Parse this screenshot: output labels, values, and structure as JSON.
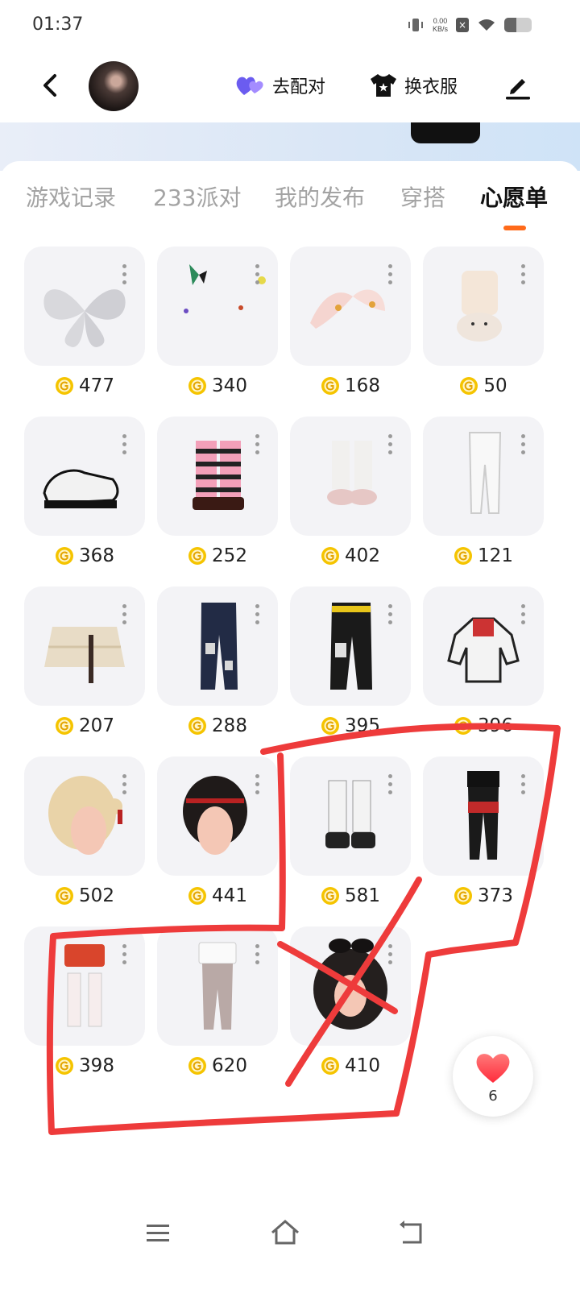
{
  "status_bar": {
    "time": "01:37",
    "net_speed_value": "0.00",
    "net_speed_unit": "KB/s",
    "battery_level": 0.45
  },
  "header": {
    "match_label": "去配对",
    "dress_label": "换衣服"
  },
  "tabs": [
    {
      "label": "游戏记录",
      "active": false
    },
    {
      "label": "233派对",
      "active": false
    },
    {
      "label": "我的发布",
      "active": false
    },
    {
      "label": "穿搭",
      "active": false
    },
    {
      "label": "心愿单",
      "active": true
    }
  ],
  "wishlist": [
    {
      "name": "white-fairy-wings",
      "price": "477"
    },
    {
      "name": "butterfly-accessory",
      "price": "340"
    },
    {
      "name": "bunny-ear-headband",
      "price": "168"
    },
    {
      "name": "bunny-socks-slippers",
      "price": "50"
    },
    {
      "name": "black-white-sneakers",
      "price": "368"
    },
    {
      "name": "pink-striped-platform-boots",
      "price": "252"
    },
    {
      "name": "lace-pink-boots",
      "price": "402"
    },
    {
      "name": "white-tights",
      "price": "121"
    },
    {
      "name": "tiered-lace-skirt",
      "price": "207"
    },
    {
      "name": "flare-jeans",
      "price": "288"
    },
    {
      "name": "black-yellow-cargo-pants",
      "price": "395"
    },
    {
      "name": "punk-jacket",
      "price": "396"
    },
    {
      "name": "blonde-bun-hair",
      "price": "502"
    },
    {
      "name": "black-ribbon-hair",
      "price": "441"
    },
    {
      "name": "butterfly-lace-up-boots",
      "price": "581"
    },
    {
      "name": "black-red-strap-leggings",
      "price": "373"
    },
    {
      "name": "red-shorts-white-stockings",
      "price": "398"
    },
    {
      "name": "white-lace-leggings",
      "price": "620"
    },
    {
      "name": "black-bow-long-hair",
      "price": "410"
    }
  ],
  "favorites": {
    "count": "6"
  },
  "colors": {
    "accent": "#ff6a1a",
    "annotation": "#ee3b3b",
    "thumb_bg": "#f3f3f6",
    "coin": "#f5c400"
  }
}
